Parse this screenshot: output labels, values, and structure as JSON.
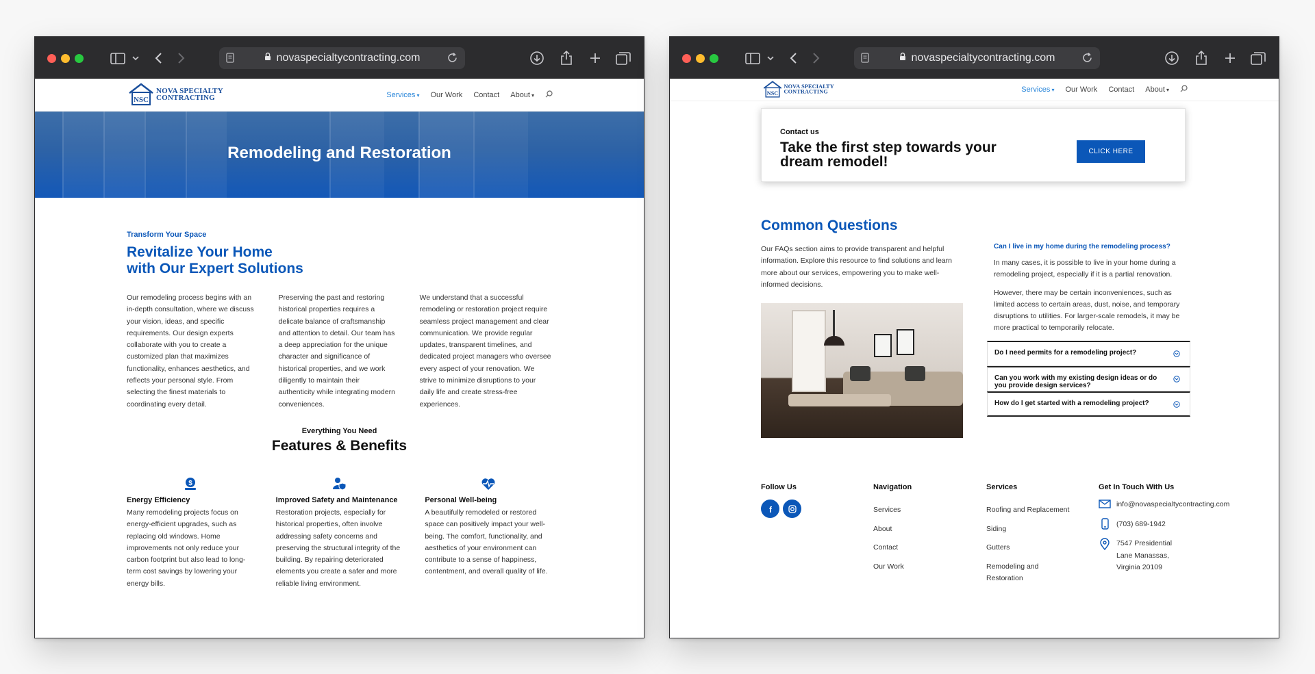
{
  "browser": {
    "url": "novaspecialtycontracting.com"
  },
  "site": {
    "logo_initials": "NSC",
    "logo_line1": "NOVA SPECIALTY",
    "logo_line2": "CONTRACTING",
    "nav": {
      "services": "Services",
      "our_work": "Our Work",
      "contact": "Contact",
      "about": "About"
    }
  },
  "left": {
    "hero_title": "Remodeling and Restoration",
    "eyebrow": "Transform Your Space",
    "heading_line1": "Revitalize Your Home",
    "heading_line2": "with Our Expert Solutions",
    "paragraphs": [
      "Our remodeling process begins with an in-depth consultation, where we discuss your vision, ideas, and specific requirements. Our design experts collaborate with you to create a customized plan that maximizes functionality, enhances aesthetics, and reflects your personal style. From selecting the finest materials to coordinating every detail.",
      "Preserving the past and restoring historical properties requires a delicate balance of craftsmanship and attention to detail. Our team has a deep appreciation for the unique character and significance of historical properties, and we work diligently to maintain their authenticity while integrating modern conveniences.",
      "We understand that a successful remodeling or restoration project require seamless project management and clear communication. We provide regular updates, transparent timelines, and dedicated project managers who oversee every aspect of your renovation. We strive to minimize disruptions to your daily life and create stress-free experiences."
    ],
    "features_eyebrow": "Everything You Need",
    "features_title": "Features & Benefits",
    "features": [
      {
        "title": "Energy Efficiency",
        "icon": "dollar-hand-icon",
        "text": "Many remodeling projects focus on energy-efficient upgrades, such as replacing old windows. Home improvements not only reduce your carbon footprint but also lead to long-term cost savings by lowering your energy bills."
      },
      {
        "title": "Improved Safety and Maintenance",
        "icon": "user-shield-icon",
        "text": "Restoration projects, especially for historical properties, often involve addressing safety concerns and preserving the structural integrity of the building. By repairing deteriorated elements you create a safer and more reliable living environment."
      },
      {
        "title": "Personal Well-being",
        "icon": "heartbeat-icon",
        "text": "A beautifully remodeled or restored space can positively impact your well-being. The comfort, functionality, and aesthetics of your environment can contribute to a sense of happiness, contentment, and overall quality of life."
      }
    ]
  },
  "right": {
    "cta_eyebrow": "Contact us",
    "cta_title": "Take the first step towards your dream remodel!",
    "cta_button": "CLICK HERE",
    "faq_title": "Common Questions",
    "faq_intro": "Our FAQs section aims to provide transparent and helpful information. Explore this resource to find solutions and learn more about our services, empowering you to make well-informed decisions.",
    "faq_open": {
      "question": "Can I live in my home during the remodeling process?",
      "answer1": "In many cases, it is possible to live in your home during a remodeling project, especially if it is a partial renovation.",
      "answer2": "However, there may be certain inconveniences, such as limited access to certain areas, dust, noise, and temporary disruptions to utilities. For larger-scale remodels, it may be more practical to temporarily relocate."
    },
    "faq_closed": [
      "Do I need permits for a remodeling project?",
      "Can you work with my existing design ideas or do you provide design services?",
      "How do I get started with a remodeling project?"
    ],
    "footer": {
      "follow_title": "Follow Us",
      "nav_title": "Navigation",
      "nav_links": [
        "Services",
        "About",
        "Contact",
        "Our Work"
      ],
      "services_title": "Services",
      "service_links": [
        "Roofing and Replacement",
        "Siding",
        "Gutters",
        "Remodeling and Restoration"
      ],
      "contact_title": "Get In Touch With Us",
      "email": "info@novaspecialtycontracting.com",
      "phone": "(703) 689-1942",
      "address": "7547 Presidential Lane Manassas, Virginia 20109"
    }
  },
  "colors": {
    "brand_blue": "#0b57b8",
    "link_blue": "#2b87da",
    "chrome": "#2c2c2e"
  }
}
